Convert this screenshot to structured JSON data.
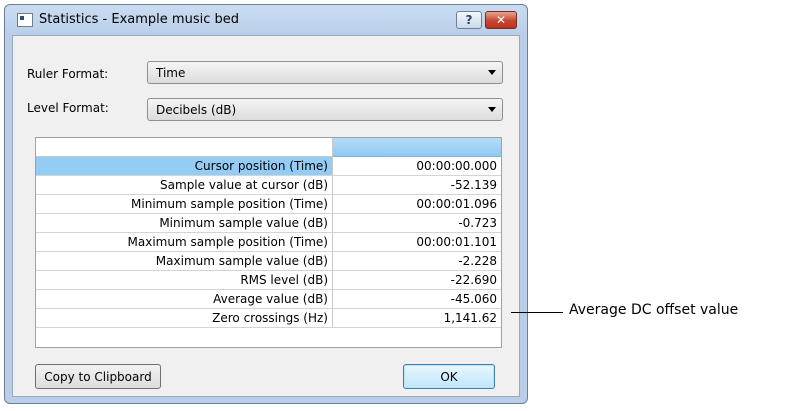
{
  "dialog": {
    "title": "Statistics - Example music bed",
    "help_label": "?",
    "close_label": "✕"
  },
  "ruler_format": {
    "label": "Ruler Format:",
    "value": "Time"
  },
  "level_format": {
    "label": "Level Format:",
    "value": "Decibels (dB)"
  },
  "stats": [
    {
      "name": "Cursor position (Time)",
      "value": "00:00:00.000"
    },
    {
      "name": "Sample value at cursor (dB)",
      "value": "-52.139"
    },
    {
      "name": "Minimum sample position (Time)",
      "value": "00:00:01.096"
    },
    {
      "name": "Minimum sample value (dB)",
      "value": "-0.723"
    },
    {
      "name": "Maximum sample position (Time)",
      "value": "00:00:01.101"
    },
    {
      "name": "Maximum sample value (dB)",
      "value": "-2.228"
    },
    {
      "name": "RMS level (dB)",
      "value": "-22.690"
    },
    {
      "name": "Average value (dB)",
      "value": "-45.060"
    },
    {
      "name": "Zero crossings (Hz)",
      "value": "1,141.62"
    }
  ],
  "buttons": {
    "copy": "Copy to Clipboard",
    "ok": "OK"
  },
  "callout": "Average DC offset value"
}
